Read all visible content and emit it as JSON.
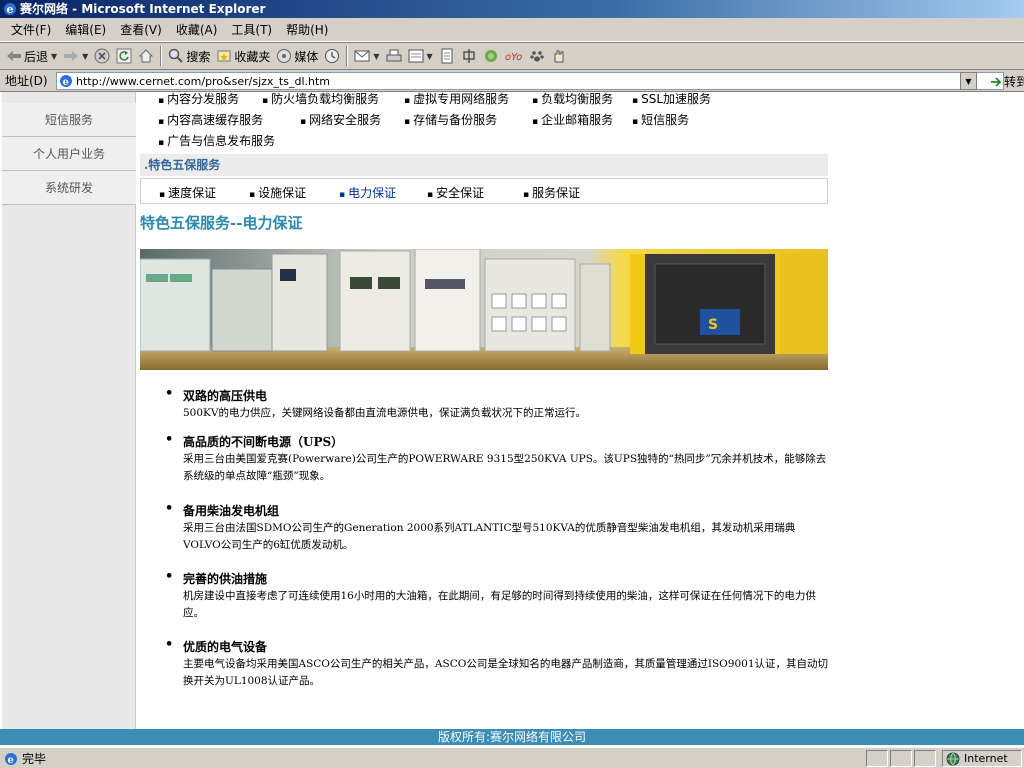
{
  "window": {
    "title": "赛尔网络 - Microsoft Internet Explorer"
  },
  "menu": [
    "文件(F)",
    "编辑(E)",
    "查看(V)",
    "收藏(A)",
    "工具(T)",
    "帮助(H)"
  ],
  "toolbar": {
    "back": "后退",
    "search": "搜索",
    "favorites": "收藏夹",
    "media": "媒体"
  },
  "address": {
    "label": "地址(D)",
    "url": "http://www.cernet.com/pro&ser/sjzx_ts_dl.htm",
    "go": "转到"
  },
  "left_nav": [
    "短信服务",
    "个人用户业务",
    "系统研发"
  ],
  "services": {
    "row1": [
      "内容分发服务",
      "防火墙负载均衡服务",
      "虚拟专用网络服务",
      "负载均衡服务",
      "SSL加速服务"
    ],
    "row2": [
      "内容高速缓存服务",
      "网络安全服务",
      "存储与备份服务",
      "企业邮箱服务",
      "短信服务"
    ],
    "row3": [
      "广告与信息发布服务"
    ]
  },
  "section": {
    "prefix": ".",
    "title": "特色五保服务",
    "items": [
      "速度保证",
      "设施保证",
      "电力保证",
      "安全保证",
      "服务保证"
    ],
    "active_color": "#003399"
  },
  "page_title": "特色五保服务--电力保证",
  "features": [
    {
      "title": "双路的高压供电",
      "body": "500KV的电力供应，关键网络设备都由直流电源供电，保证满负载状况下的正常运行。"
    },
    {
      "title": "高品质的不间断电源（UPS）",
      "body": "采用三台由美国爱克赛(Powerware)公司生产的POWERWARE 9315型250KVA UPS。该UPS独特的“热同步”冗余并机技术，能够除去系统级的单点故障“瓶颈”现象。"
    },
    {
      "title": "备用柴油发电机组",
      "body": "采用三台由法国SDMO公司生产的Generation 2000系列ATLANTIC型号510KVA的优质静音型柴油发电机组，其发动机采用瑞典VOLVO公司生产的6缸优质发动机。"
    },
    {
      "title": "完善的供油措施",
      "body": "机房建设中直接考虑了可连续使用16小时用的大油箱，在此期间，有足够的时间得到持续使用的柴油，这样可保证在任何情况下的电力供应。"
    },
    {
      "title": "优质的电气设备",
      "body": "主要电气设备均采用美国ASCO公司生产的相关产品，ASCO公司是全球知名的电器产品制造商，其质量管理通过ISO9001认证，其自动切换开关为UL1008认证产品。"
    }
  ],
  "footer": "版权所有:赛尔网络有限公司",
  "status": {
    "text": "完毕",
    "zone": "Internet"
  },
  "colors": {
    "accent": "#2a8ab0",
    "footer_bg": "#3b8db5",
    "section_head": "#336699"
  }
}
